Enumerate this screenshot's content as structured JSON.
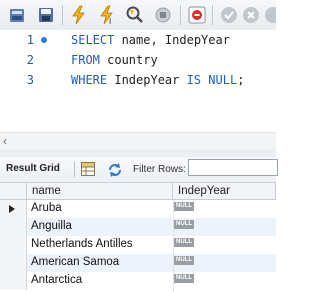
{
  "toolbar": {
    "buttons": [
      {
        "name": "open-file-icon",
        "label": "open"
      },
      {
        "name": "save-icon",
        "label": "save"
      },
      {
        "name": "execute-icon",
        "label": "execute"
      },
      {
        "name": "execute-current-icon",
        "label": "execute-current"
      },
      {
        "name": "explain-icon",
        "label": "explain"
      },
      {
        "name": "stop-icon",
        "label": "stop"
      },
      {
        "name": "toggle-error-icon",
        "label": "stop-on-error"
      },
      {
        "name": "commit-icon",
        "label": "commit"
      },
      {
        "name": "rollback-icon",
        "label": "rollback"
      },
      {
        "name": "autocommit-icon",
        "label": "autocommit"
      }
    ]
  },
  "editor": {
    "lines": [
      {
        "number": "1",
        "parts": [
          {
            "k": true,
            "t": "SELECT"
          },
          {
            "k": false,
            "t": " name, IndepYear"
          }
        ]
      },
      {
        "number": "2",
        "parts": [
          {
            "k": true,
            "t": "FROM"
          },
          {
            "k": false,
            "t": " country"
          }
        ]
      },
      {
        "number": "3",
        "parts": [
          {
            "k": true,
            "t": "WHERE"
          },
          {
            "k": false,
            "t": " IndepYear "
          },
          {
            "k": true,
            "t": "IS NULL"
          },
          {
            "k": false,
            "t": ";"
          }
        ]
      }
    ]
  },
  "result": {
    "grid_label": "Result Grid",
    "filter_label": "Filter Rows:",
    "filter_value": ""
  },
  "grid": {
    "columns": [
      "name",
      "IndepYear"
    ],
    "null_badge": "NULL",
    "rows": [
      "Aruba",
      "Anguilla",
      "Netherlands Antilles",
      "American Samoa",
      "Antarctica"
    ]
  },
  "colors": {
    "keyword": "#1f5fbf",
    "line_number": "#2e5a93",
    "null_badge": "#9a9fa6",
    "alt_row": "#edf3fb"
  }
}
